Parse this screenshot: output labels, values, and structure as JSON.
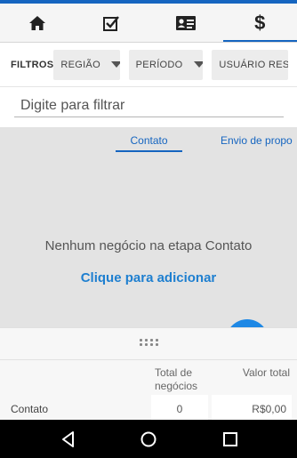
{
  "tabs": [
    {
      "icon": "home-icon",
      "active": false
    },
    {
      "icon": "checkbox-icon",
      "active": false
    },
    {
      "icon": "contact-card-icon",
      "active": false
    },
    {
      "icon": "dollar-icon",
      "active": true,
      "glyph": "$"
    }
  ],
  "filters": {
    "label": "FILTROS",
    "region": "REGIÃO",
    "period": "PERÍODO",
    "user": "USUÁRIO RESPO"
  },
  "search": {
    "placeholder": "Digite para filtrar",
    "value": ""
  },
  "stages": {
    "active": "Contato",
    "next": "Envio de propo"
  },
  "empty": {
    "message": "Nenhum negócio na etapa Contato",
    "action": "Clique para adicionar"
  },
  "summary": {
    "col_total": "Total de negócios",
    "col_value": "Valor total",
    "rows": [
      {
        "label": "Contato",
        "total": "0",
        "value": "R$0,00"
      }
    ]
  },
  "colors": {
    "accent": "#1565c0",
    "link": "#1e7fd0",
    "fab": "#1e88e5"
  }
}
